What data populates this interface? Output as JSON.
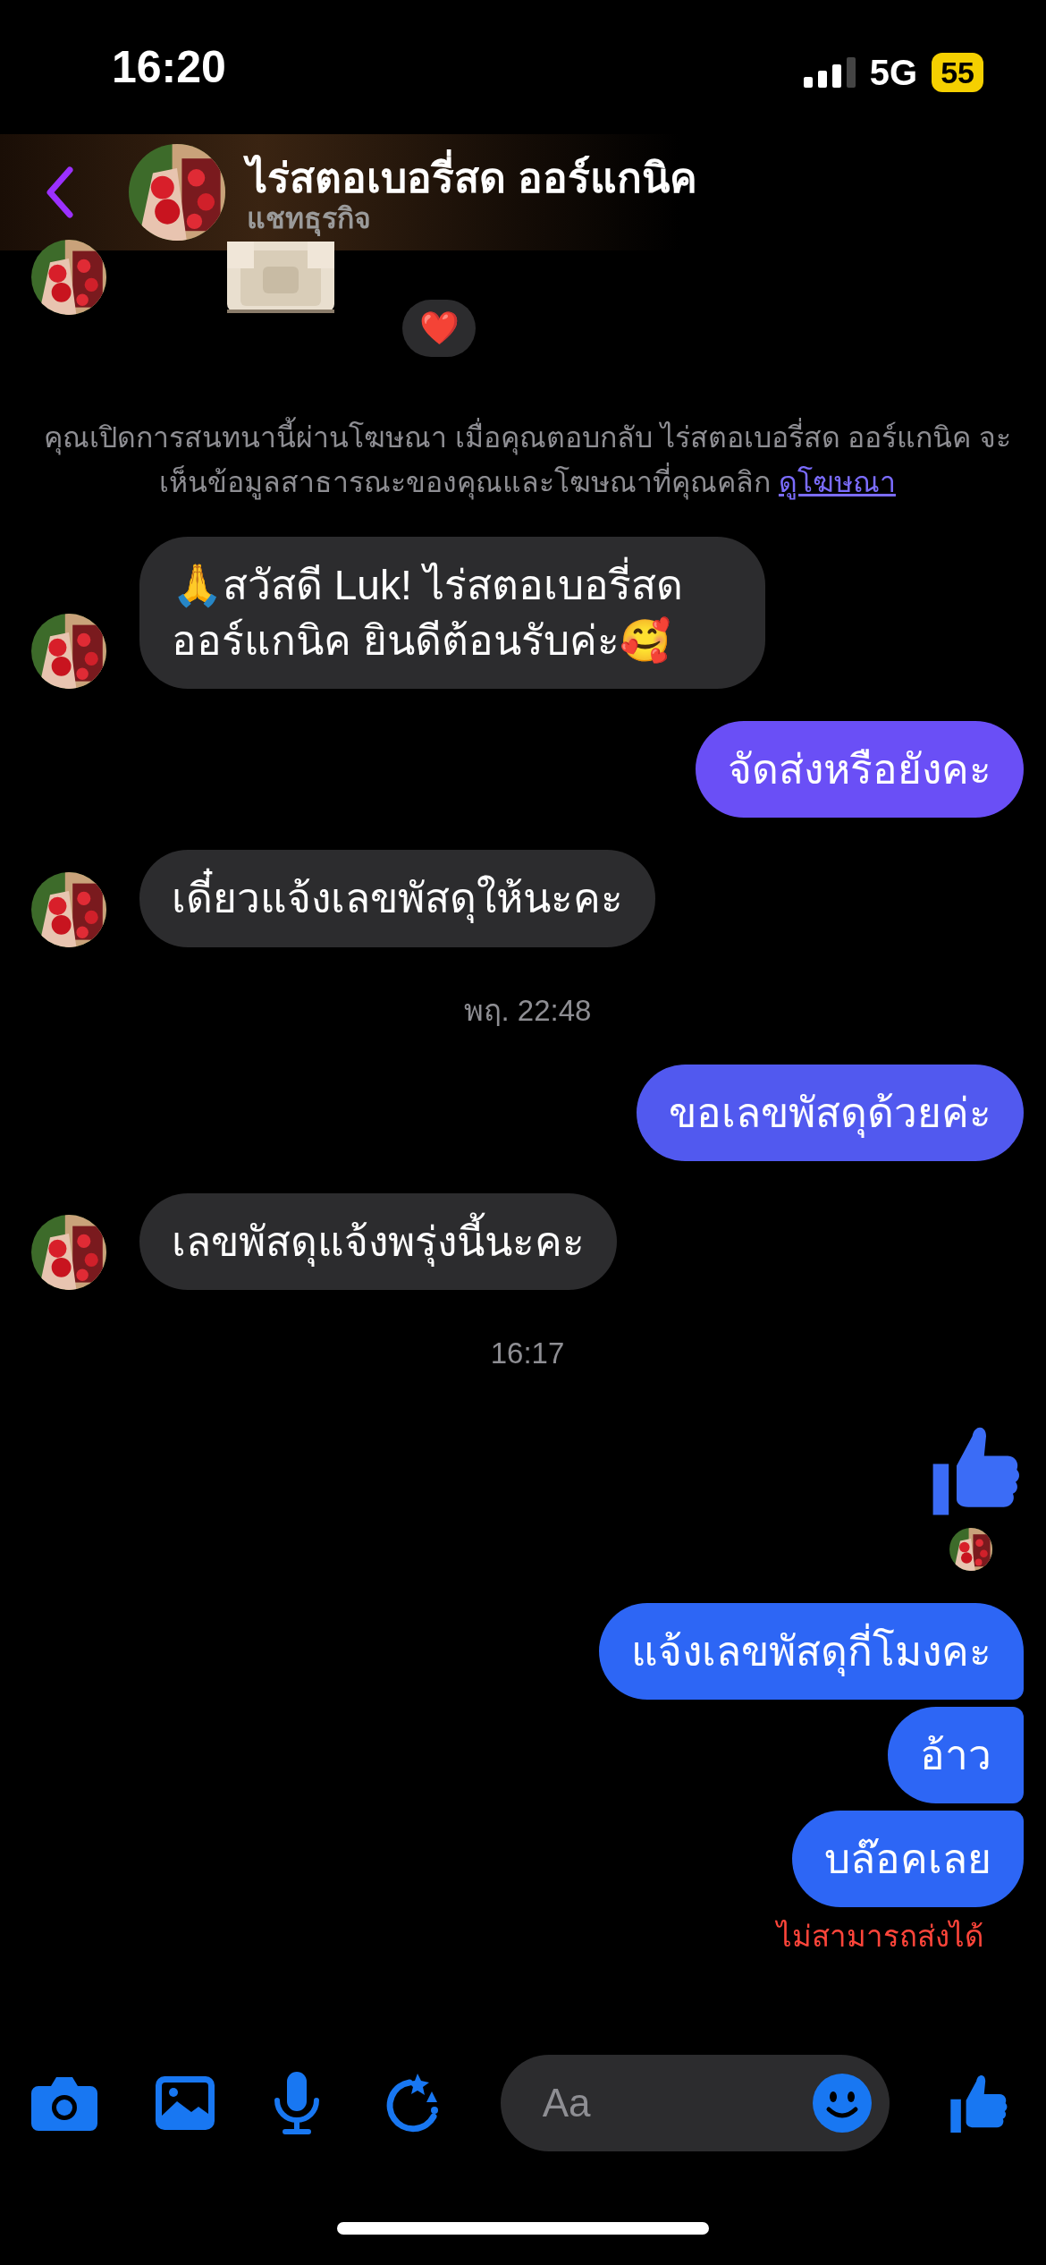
{
  "status_bar": {
    "time": "16:20",
    "network": "5G",
    "battery": "55"
  },
  "header": {
    "title": "ไร่สตอเบอรี่สด ออร์แกนิค",
    "subtitle": "แชทธุรกิจ"
  },
  "messages": [
    {
      "kind": "sticker",
      "reaction": "❤️"
    },
    {
      "kind": "notice",
      "text": "คุณเปิดการสนทนานี้ผ่านโฆษณา เมื่อคุณตอบกลับ ไร่สตอเบอรี่สด ออร์แกนิค จะเห็นข้อมูลสาธารณะของคุณและโฆษณาที่คุณคลิก",
      "link": "ดูโฆษณา"
    },
    {
      "kind": "incoming",
      "text": "🙏สวัสดี Luk! ไร่สตอเบอรี่สด ออร์แกนิค ยินดีต้อนรับค่ะ🥰"
    },
    {
      "kind": "outgoing",
      "text": "จัดส่งหรือยังคะ",
      "color": "#6a4ff6"
    },
    {
      "kind": "incoming",
      "text": "เดี๋ยวแจ้งเลขพัสดุให้นะคะ"
    },
    {
      "kind": "time",
      "text": "พฤ. 22:48"
    },
    {
      "kind": "outgoing",
      "text": "ขอเลขพัสดุด้วยค่ะ",
      "color": "#5159ef"
    },
    {
      "kind": "incoming",
      "text": "เลขพัสดุแจ้งพรุ่งนี้นะคะ"
    },
    {
      "kind": "time",
      "text": "16:17"
    },
    {
      "kind": "like"
    },
    {
      "kind": "seen"
    },
    {
      "kind": "outgoing",
      "text": "แจ้งเลขพัสดุกี่โมงคะ",
      "color": "#2d66f5"
    },
    {
      "kind": "outgoing",
      "text": "อ้าว",
      "color": "#2d66f5"
    },
    {
      "kind": "outgoing",
      "text": "บล๊อคเลย",
      "color": "#2d66f5"
    },
    {
      "kind": "error",
      "text": "ไม่สามารถส่งได้"
    }
  ],
  "composer": {
    "placeholder": "Aa"
  }
}
